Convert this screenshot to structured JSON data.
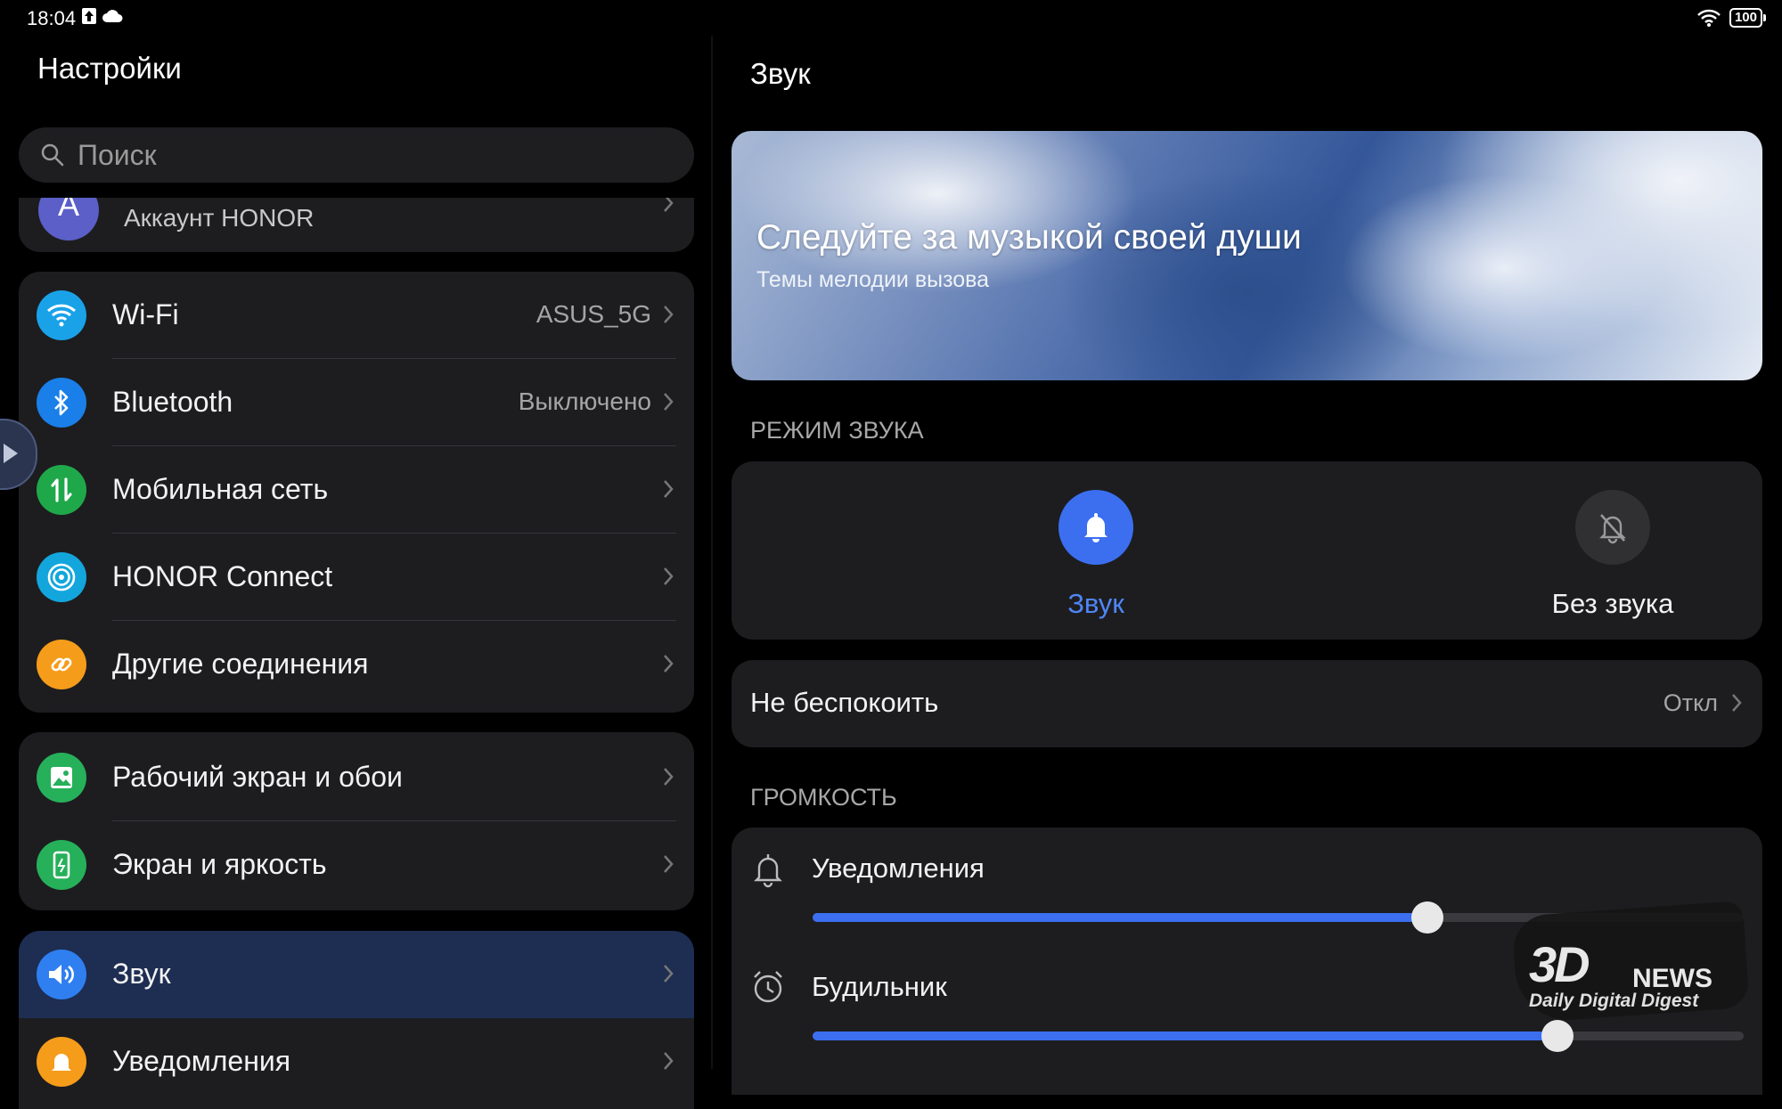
{
  "status_bar": {
    "time": "18:04",
    "battery": "100"
  },
  "left": {
    "title": "Настройки",
    "search": {
      "placeholder": "Поиск"
    },
    "account": {
      "avatar_letter": "A",
      "label": "Аккаунт HONOR"
    },
    "group1": [
      {
        "label": "Wi-Fi",
        "value": "ASUS_5G",
        "icon": "wifi-icon",
        "color": "#1aa2e8"
      },
      {
        "label": "Bluetooth",
        "value": "Выключено",
        "icon": "bluetooth-icon",
        "color": "#1a7fe8"
      },
      {
        "label": "Мобильная сеть",
        "value": "",
        "icon": "mobile-data-icon",
        "color": "#1fa84a"
      },
      {
        "label": "HONOR Connect",
        "value": "",
        "icon": "honor-connect-icon",
        "color": "#13a6dc"
      },
      {
        "label": "Другие соединения",
        "value": "",
        "icon": "link-icon",
        "color": "#f59c1a"
      }
    ],
    "group2": [
      {
        "label": "Рабочий экран и обои",
        "icon": "wallpaper-icon",
        "color": "#26b05a"
      },
      {
        "label": "Экран и яркость",
        "icon": "display-icon",
        "color": "#26b05a"
      }
    ],
    "group3": [
      {
        "label": "Звук",
        "icon": "sound-icon",
        "color": "#2f7ff0",
        "selected": true
      },
      {
        "label": "Уведомления",
        "icon": "notification-icon",
        "color": "#f59c1a"
      }
    ]
  },
  "right": {
    "title": "Звук",
    "banner": {
      "title": "Следуйте за музыкой своей души",
      "subtitle": "Темы мелодии вызова"
    },
    "sound_mode": {
      "header": "РЕЖИМ ЗВУКА",
      "options": [
        {
          "label": "Звук",
          "active": true
        },
        {
          "label": "Без звука",
          "active": false
        }
      ]
    },
    "dnd": {
      "label": "Не беспокоить",
      "value": "Откл"
    },
    "volume": {
      "header": "ГРОМКОСТЬ",
      "sliders": [
        {
          "label": "Уведомления",
          "level": 0.66
        },
        {
          "label": "Будильник",
          "level": 0.8
        }
      ]
    }
  },
  "watermark": {
    "brand": "3D",
    "news": "NEWS",
    "tagline": "Daily Digital Digest"
  },
  "colors": {
    "accent": "#3b6ff0",
    "background": "#000000",
    "card": "#1d1d20",
    "selected_row": "#1e2d52"
  }
}
